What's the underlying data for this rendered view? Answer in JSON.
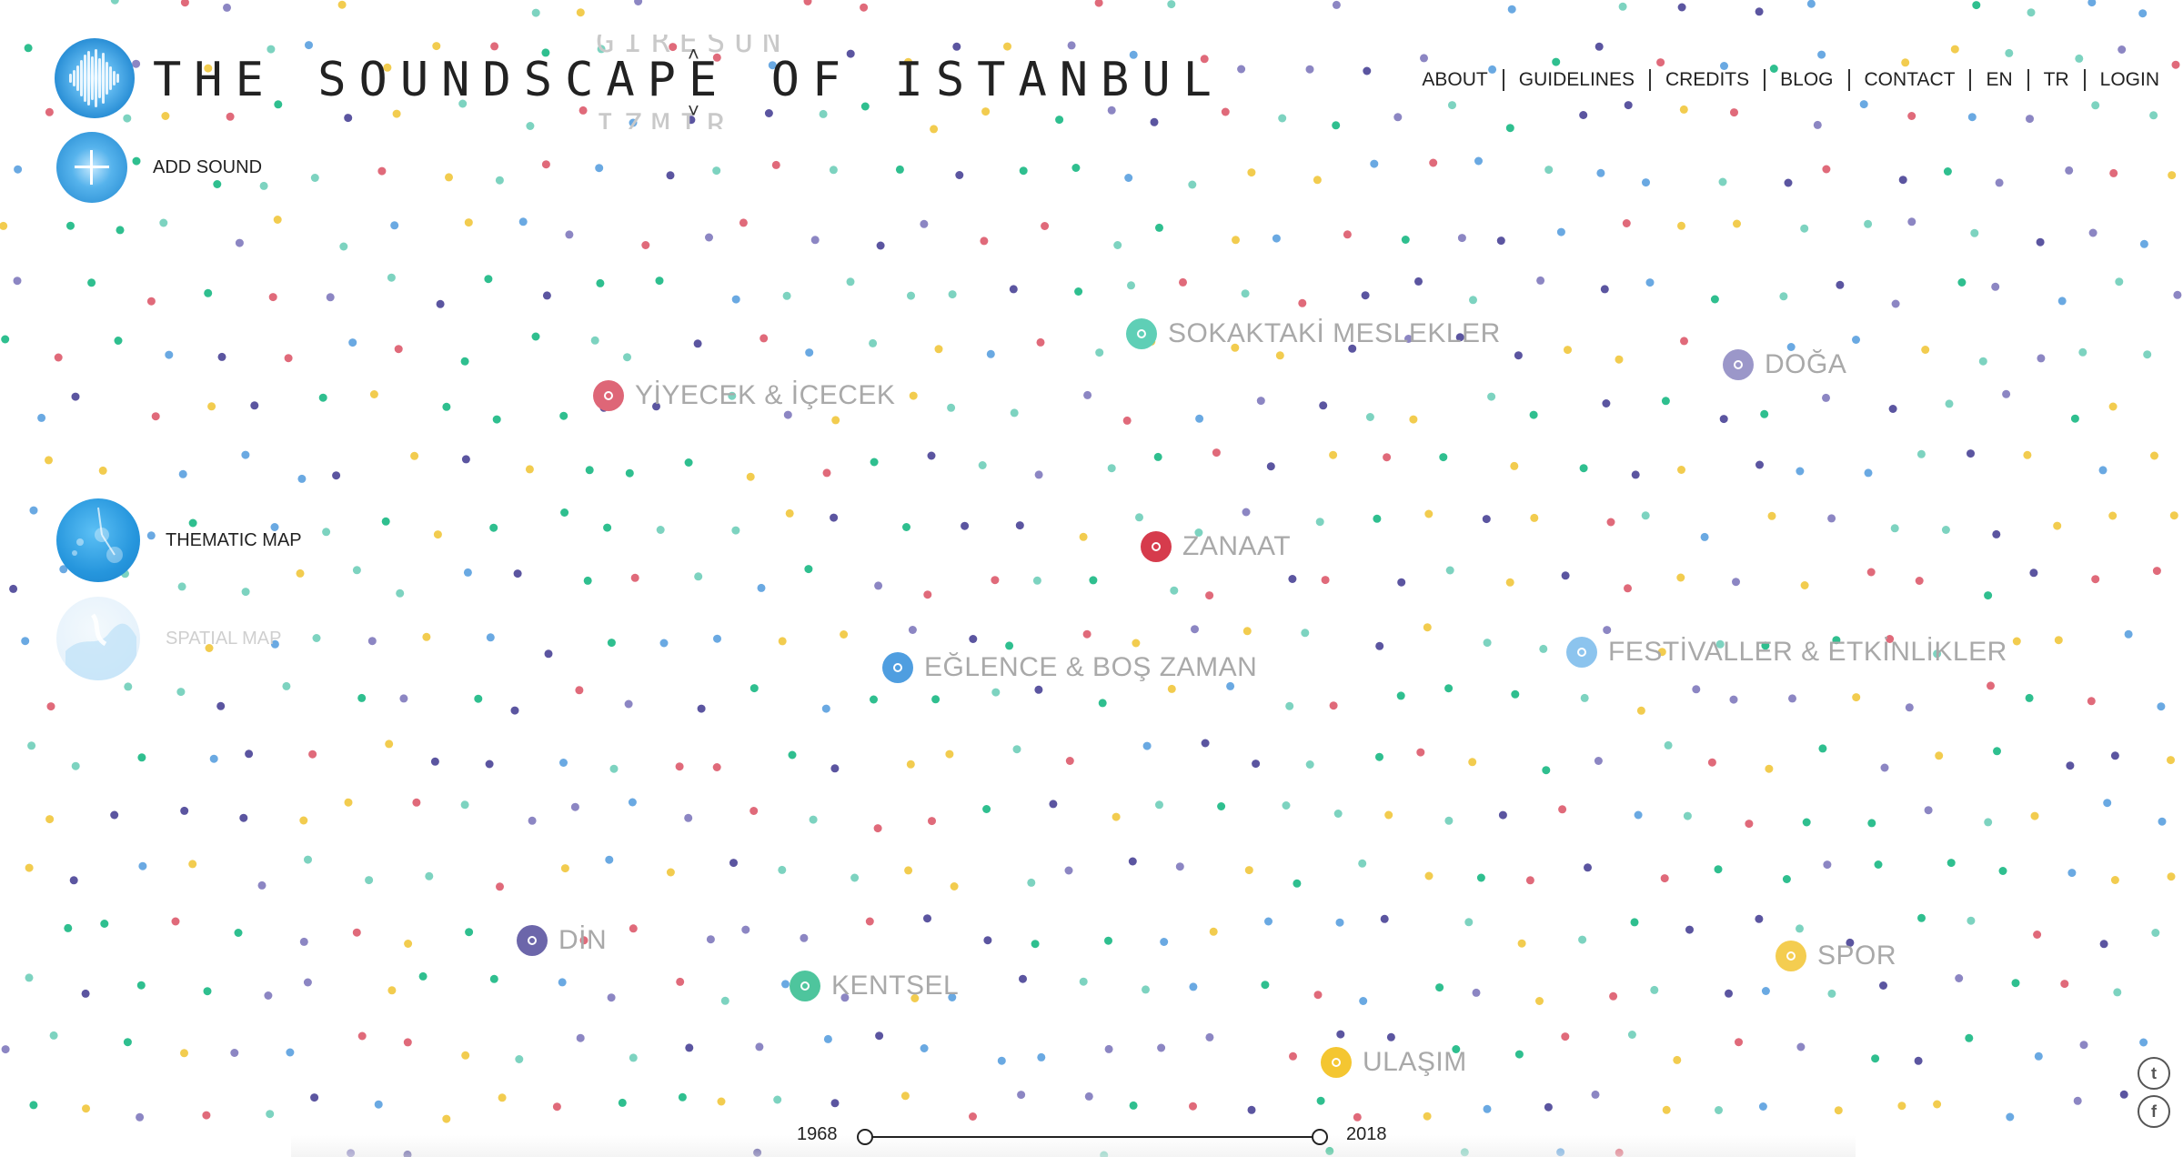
{
  "header": {
    "title": "THE SOUNDSCAPE OF ISTANBUL",
    "prev_city": "GIRESUN",
    "next_city": "IZMIR"
  },
  "nav": {
    "items": [
      "ABOUT",
      "GUIDELINES",
      "CREDITS",
      "BLOG",
      "CONTACT",
      "EN",
      "TR",
      "LOGIN"
    ]
  },
  "tools": {
    "add_sound": "ADD SOUND",
    "thematic_map": "THEMATIC MAP",
    "spatial_map": "SPATIAL MAP"
  },
  "categories": [
    {
      "name": "SOKAKTAKİ MESLEKLER",
      "color": "#5fcfb6"
    },
    {
      "name": "DOĞA",
      "color": "#9b97c9"
    },
    {
      "name": "YİYECEK & İÇECEK",
      "color": "#de6677"
    },
    {
      "name": "ZANAAT",
      "color": "#d63b4c"
    },
    {
      "name": "EĞLENCE & BOŞ ZAMAN",
      "color": "#4f9ee0"
    },
    {
      "name": "FESTİVALLER & ETKİNLİKLER",
      "color": "#8cc4ee"
    },
    {
      "name": "DİN",
      "color": "#6c66aa"
    },
    {
      "name": "KENTSEL",
      "color": "#4ec59d"
    },
    {
      "name": "SPOR",
      "color": "#f4cd50"
    },
    {
      "name": "ULAŞIM",
      "color": "#f4c631"
    }
  ],
  "dot_colors": [
    "#7dd3c0",
    "#f2cc4f",
    "#e06a7a",
    "#6aa9e2",
    "#8c86c3",
    "#2fbf8f",
    "#5b55a0"
  ],
  "timeline": {
    "start": "1968",
    "end": "2018"
  },
  "social": {
    "twitter": "twitter-icon",
    "facebook": "facebook-icon"
  }
}
